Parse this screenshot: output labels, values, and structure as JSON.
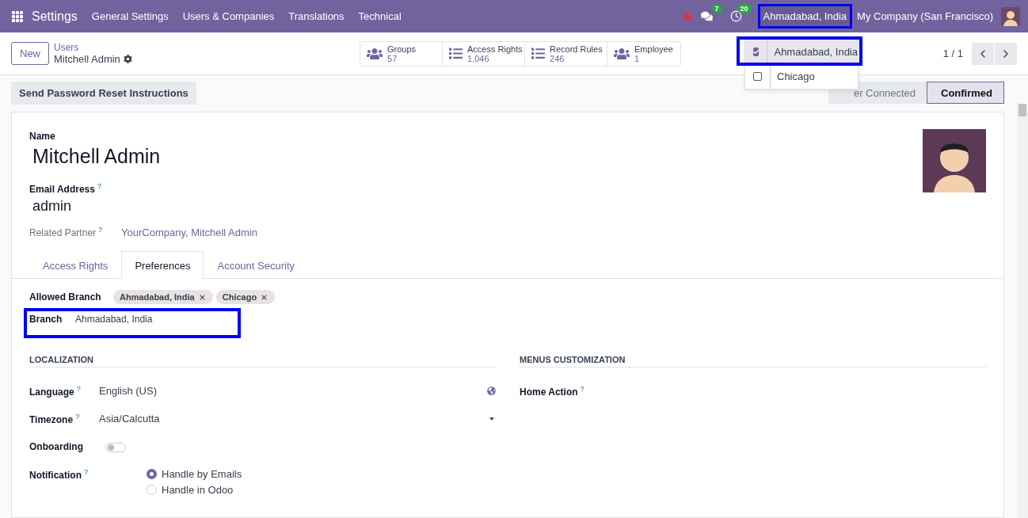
{
  "navbar": {
    "app_title": "Settings",
    "menus": [
      "General Settings",
      "Users & Companies",
      "Translations",
      "Technical"
    ],
    "messages_count": "7",
    "activities_count": "20",
    "branch_switcher": {
      "label": "Ahmadabad, India",
      "highlighted": true
    },
    "company": "My Company (San Francisco)"
  },
  "branch_dropdown": [
    {
      "label": "Ahmadabad, India",
      "checked": true,
      "highlighted": true
    },
    {
      "label": "Chicago",
      "checked": false,
      "highlighted": false
    }
  ],
  "control_panel": {
    "new_button": "New",
    "breadcrumb": "Users",
    "record_title": "Mitchell Admin",
    "pager": "1 / 1",
    "smart_buttons": [
      {
        "kind": "users",
        "label": "Groups",
        "value": "57"
      },
      {
        "kind": "list",
        "label": "Access Rights",
        "value": "1,046"
      },
      {
        "kind": "list",
        "label": "Record Rules",
        "value": "246"
      },
      {
        "kind": "users",
        "label": "Employee",
        "value": "1"
      }
    ]
  },
  "action_button": "Send Password Reset Instructions",
  "statusbar": [
    {
      "label": "er Connected",
      "selected": false
    },
    {
      "label": "Confirmed",
      "selected": true
    }
  ],
  "form": {
    "name_label": "Name",
    "name": "Mitchell Admin",
    "email_label": "Email Address",
    "email_tooltip": "?",
    "email": "admin",
    "partner_label": "Related Partner",
    "partner_tooltip": "?",
    "partner": "YourCompany, Mitchell Admin",
    "tabs": [
      {
        "label": "Access Rights",
        "selected": false
      },
      {
        "label": "Preferences",
        "selected": true
      },
      {
        "label": "Account Security",
        "selected": false
      }
    ],
    "allowed_branch": {
      "label": "Allowed Branch",
      "tags": [
        "Ahmadabad, India",
        "Chicago"
      ]
    },
    "branch": {
      "label": "Branch",
      "value": "Ahmadabad, India",
      "highlighted": true
    },
    "localization": {
      "title": "LOCALIZATION",
      "fields": [
        {
          "kind": "globe-select",
          "label": "Language",
          "tooltip": "?",
          "value": "English (US)"
        },
        {
          "kind": "select",
          "label": "Timezone",
          "tooltip": "?",
          "value": "Asia/Calcutta"
        },
        {
          "kind": "toggle",
          "label": "Onboarding",
          "on": false
        },
        {
          "kind": "radio",
          "label": "Notification",
          "tooltip": "?",
          "options": [
            {
              "label": "Handle by Emails",
              "selected": true
            },
            {
              "label": "Handle in Odoo",
              "selected": false
            }
          ]
        }
      ]
    },
    "menus_customization": {
      "title": "MENUS CUSTOMIZATION",
      "fields": [
        {
          "kind": "empty",
          "label": "Home Action",
          "tooltip": "?"
        }
      ]
    }
  }
}
